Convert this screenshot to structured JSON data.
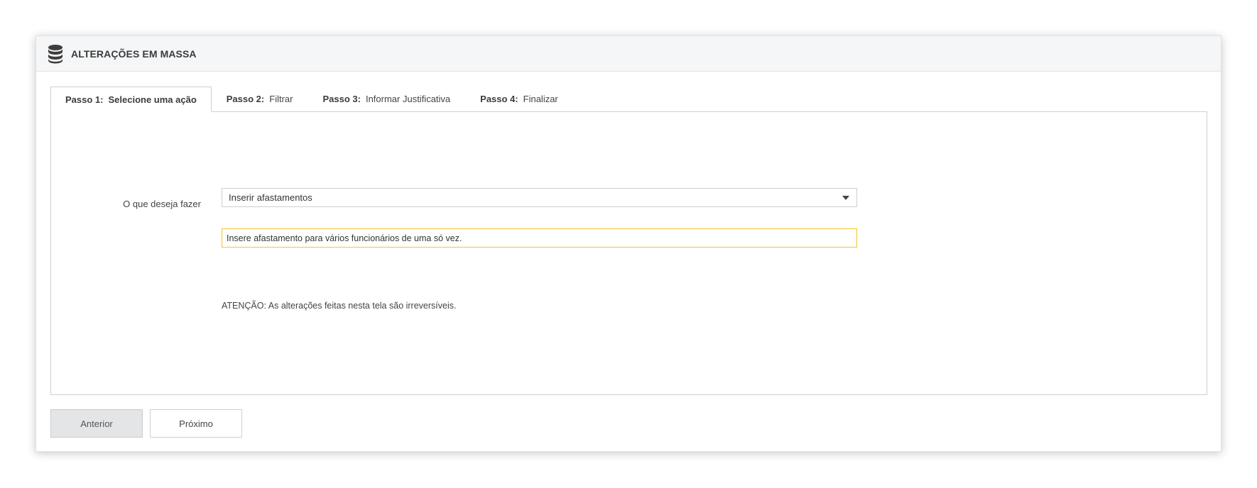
{
  "header": {
    "title": "ALTERAÇÕES EM MASSA",
    "icon": "database-icon"
  },
  "tabs": [
    {
      "step": "Passo 1:",
      "label": "Selecione uma ação",
      "active": true
    },
    {
      "step": "Passo 2:",
      "label": "Filtrar",
      "active": false
    },
    {
      "step": "Passo 3:",
      "label": "Informar Justificativa",
      "active": false
    },
    {
      "step": "Passo 4:",
      "label": "Finalizar",
      "active": false
    }
  ],
  "form": {
    "action_label": "O que deseja fazer",
    "action_value": "Inserir afastamentos",
    "action_hint": "Insere afastamento para vários funcionários de uma só vez.",
    "warning": "ATENÇÃO: As alterações feitas nesta tela são irreversíveis."
  },
  "footer": {
    "previous_label": "Anterior",
    "next_label": "Próximo"
  },
  "colors": {
    "hint_border": "#f3c433",
    "header_bg": "#f5f6f7",
    "disabled_button_bg": "#e4e5e7"
  }
}
